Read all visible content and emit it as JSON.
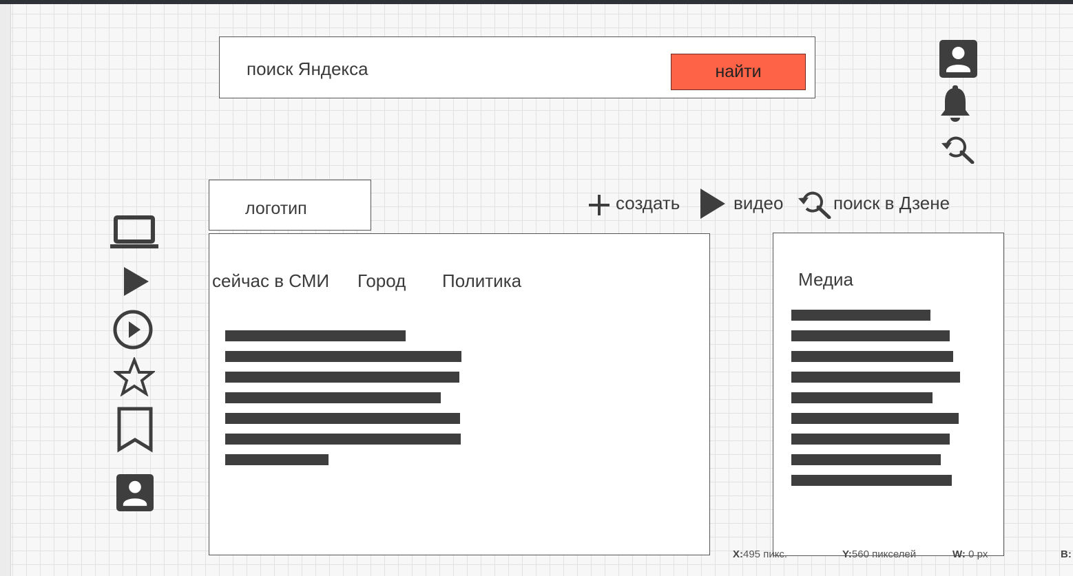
{
  "search": {
    "placeholder_text": "поиск Яндекса",
    "button_label": "найти"
  },
  "header": {
    "logo_text": "логотип",
    "create_label": "создать",
    "video_label": "видео",
    "zen_search_label": "поиск в Дзене"
  },
  "top_right_icons": [
    "account-icon",
    "bell-icon",
    "search-history-icon"
  ],
  "sidebar": {
    "icons": [
      "laptop-icon",
      "play-icon",
      "play-circle-icon",
      "star-icon",
      "bookmark-icon",
      "account-icon"
    ]
  },
  "main": {
    "tabs": [
      {
        "label": "сейчас в СМИ"
      },
      {
        "label": "Город"
      },
      {
        "label": "Политика"
      }
    ]
  },
  "media": {
    "title": "Медиа"
  },
  "status": {
    "x_label": "X:",
    "x_value": "495 пикс.",
    "y_label": "Y:",
    "y_value": "560 пикселей",
    "w_label": "W:",
    "w_value": "0 px",
    "b_label": "B:"
  },
  "colors": {
    "accent": "#ff6347",
    "icon": "#3e3e3e",
    "placeholder_bar": "#3e3e3e"
  }
}
